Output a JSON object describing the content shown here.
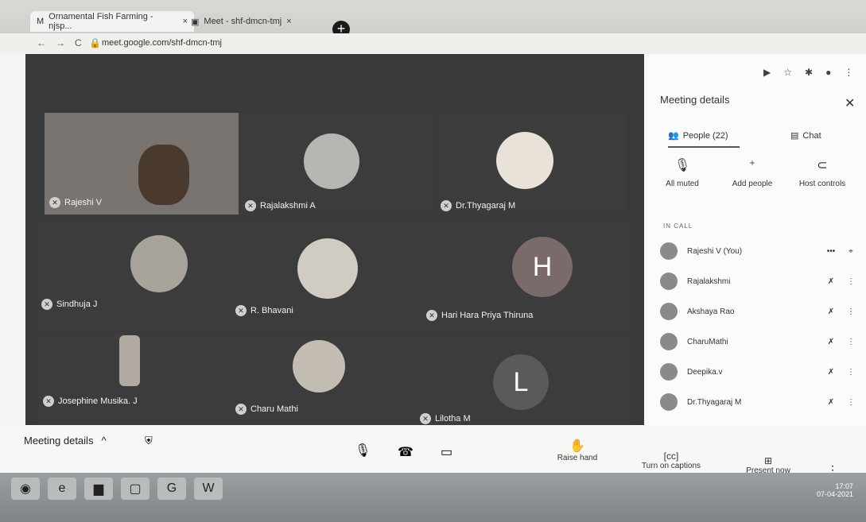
{
  "browser": {
    "tabs": [
      {
        "title": "Ornamental Fish Farming - njsp..."
      },
      {
        "title": "Meet - shf-dmcn-tmj"
      }
    ],
    "url": "meet.google.com/shf-dmcn-tmj"
  },
  "participants_grid": [
    {
      "name": "Rajeshi V",
      "type": "video"
    },
    {
      "name": "Rajalakshmi A",
      "type": "photo"
    },
    {
      "name": "Dr.Thyagaraj M",
      "type": "photo"
    },
    {
      "name": "Sindhuja J",
      "type": "photo"
    },
    {
      "name": "R. Bhavani",
      "type": "photo"
    },
    {
      "name": "Hari Hara Priya Thiruna",
      "type": "letter",
      "letter": "H",
      "color": "#7a6a6a"
    },
    {
      "name": "Josephine Musika. J",
      "type": "photo"
    },
    {
      "name": "Charu Mathi",
      "type": "photo"
    },
    {
      "name": "Lilotha M",
      "type": "letter",
      "letter": "L",
      "color": "#5a5a5a"
    }
  ],
  "panel": {
    "title": "Meeting details",
    "people_tab": "People (22)",
    "chat_tab": "Chat",
    "actions": [
      "All muted",
      "Add people",
      "Host controls"
    ],
    "section": "IN CALL",
    "people": [
      {
        "name": "Rajeshi V (You)",
        "icon1": "•••",
        "icon2": "pin"
      },
      {
        "name": "Rajalakshmi",
        "icon1": "muted",
        "icon2": "more"
      },
      {
        "name": "Akshaya Rao",
        "icon1": "muted",
        "icon2": "more"
      },
      {
        "name": "CharuMathi",
        "icon1": "muted",
        "icon2": "more"
      },
      {
        "name": "Deepika.v",
        "icon1": "muted",
        "icon2": "more"
      },
      {
        "name": "Dr.Thyagaraj M",
        "icon1": "muted",
        "icon2": "more"
      }
    ]
  },
  "bottom_bar": {
    "meeting_details": "Meeting details",
    "raise_hand": "Raise hand",
    "captions": "Turn on captions",
    "present": "Present now"
  },
  "taskbar": {
    "time": "17:07",
    "date": "07-04-2021"
  }
}
